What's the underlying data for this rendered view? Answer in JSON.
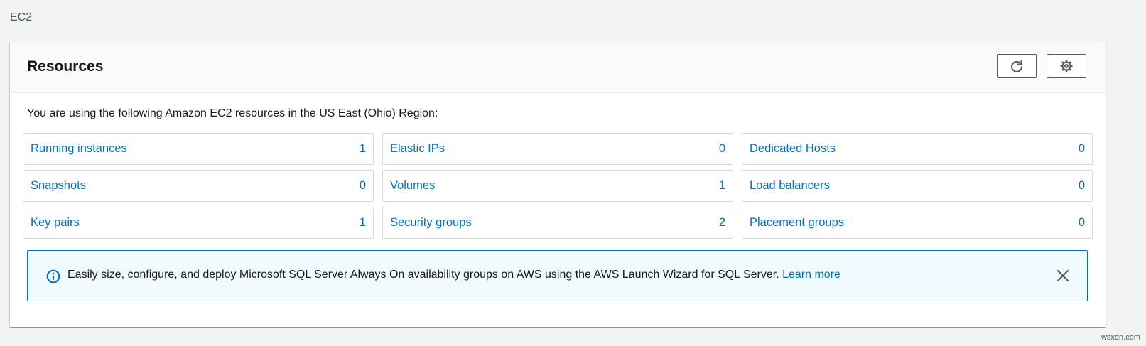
{
  "breadcrumb": "EC2",
  "panel": {
    "title": "Resources",
    "intro": "You are using the following Amazon EC2 resources in the US East (Ohio) Region:"
  },
  "resources": [
    {
      "label": "Running instances",
      "count": "1"
    },
    {
      "label": "Elastic IPs",
      "count": "0"
    },
    {
      "label": "Dedicated Hosts",
      "count": "0"
    },
    {
      "label": "Snapshots",
      "count": "0"
    },
    {
      "label": "Volumes",
      "count": "1"
    },
    {
      "label": "Load balancers",
      "count": "0"
    },
    {
      "label": "Key pairs",
      "count": "1"
    },
    {
      "label": "Security groups",
      "count": "2"
    },
    {
      "label": "Placement groups",
      "count": "0"
    }
  ],
  "info": {
    "text": "Easily size, configure, and deploy Microsoft SQL Server Always On availability groups on AWS using the AWS Launch Wizard for SQL Server. ",
    "link": "Learn more"
  },
  "watermark": "wsxdn.com",
  "icons": {
    "refresh": "refresh-icon",
    "settings": "gear-icon",
    "info": "info-icon",
    "close": "close-icon"
  },
  "colors": {
    "link": "#0073bb",
    "info_background": "#f1faff",
    "page_background": "#f2f3f3"
  }
}
